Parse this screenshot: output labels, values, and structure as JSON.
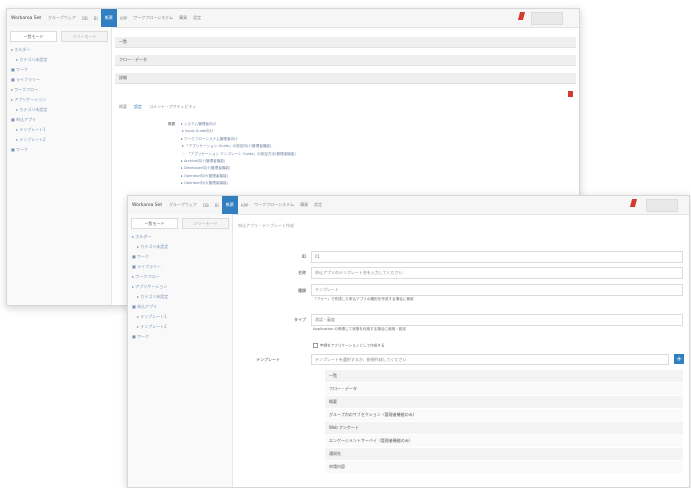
{
  "header": {
    "brand": "Workarea Set",
    "menu": [
      "グループウェア",
      "DB",
      "BI",
      "帳票",
      "APP",
      "ワークフローシステム",
      "購買",
      "設定"
    ],
    "active_index": 3
  },
  "sidebar": {
    "tabs": [
      "一覧モード",
      "ツリーモード"
    ],
    "items": [
      {
        "label": "▸ ホルダー",
        "sub": false
      },
      {
        "label": "▸ カテゴリ未設定",
        "sub": true
      },
      {
        "label": "■ ワーク",
        "sub": false
      },
      {
        "label": "■ ライブラリー",
        "sub": false
      },
      {
        "label": "▸ ワークフロー",
        "sub": false
      },
      {
        "label": "▸ アプリケーション",
        "sub": false
      },
      {
        "label": "▸ カテゴリ未設定",
        "sub": true
      },
      {
        "label": "■ 申込アプリ",
        "sub": false
      },
      {
        "label": "▸ テンプレート1",
        "sub": true
      },
      {
        "label": "▸ テンプレート2",
        "sub": true
      },
      {
        "label": "■ ワーク",
        "sub": false
      }
    ]
  },
  "back_window": {
    "rows": [
      "一覧",
      "フロー・データ",
      "詳細"
    ],
    "tabs": [
      "概要",
      "設定",
      "コメント・アクティビティ"
    ],
    "tree": [
      {
        "lead": "概要",
        "text": "▸ システム管理者向け"
      },
      {
        "lead": "",
        "text": "  ▸ Input Guide向け"
      },
      {
        "lead": "",
        "text": "▸ ワークフローシステム管理者向け"
      },
      {
        "lead": "",
        "text": "  ▸ 「アプリケーション Guide」の設定向け(管理者機能)"
      },
      {
        "lead": "",
        "text": "    ・ 「アプリケーション テンプレート Guide」の設定方法(管理者機能)"
      },
      {
        "lead": "",
        "text": "▸ Archive向け(管理者機能)"
      },
      {
        "lead": "",
        "text": "▸ Developer向け(管理者機能)"
      },
      {
        "lead": "",
        "text": "▸ Operator向け(管理者機能)"
      },
      {
        "lead": "",
        "text": "▸ Operator向け(管理者機能)"
      }
    ]
  },
  "front_window": {
    "breadcrumb": "申込アプリ・テンプレート作成",
    "fields": [
      {
        "label": "ID",
        "value": "01"
      },
      {
        "label": "名称",
        "value": "申込アプリのテンプレート名を入力してください"
      },
      {
        "label": "種類",
        "value": "テンプレート",
        "note": "「フリー」で作成した申込アプリの雛形を作成する場合に使用"
      },
      {
        "label": "タイプ",
        "value": "承認・審査",
        "note": "Application の申請して状態を利用する場合に使用・設定"
      }
    ],
    "checkbox_label": "申請をアプリケーションとして作成する",
    "template_label": "テンプレート",
    "template_placeholder": "テンプレートを選択するか、新規作成してください",
    "add_label": "+",
    "templates": [
      "一覧",
      "フロー・データ",
      "概要",
      "グループ内のサブセクション（管理者機能のみ）",
      "Web アンケート",
      "エンゲージメントサーベイ（管理者機能のみ）",
      "通知先",
      "申請内容"
    ]
  }
}
